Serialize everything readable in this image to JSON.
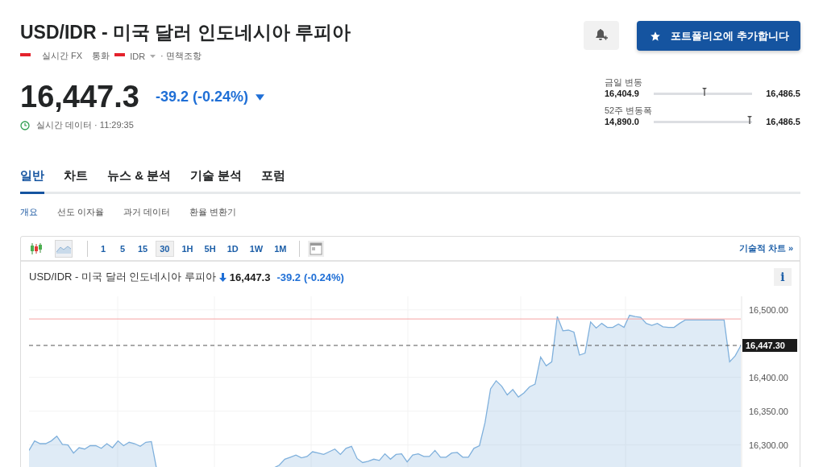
{
  "header": {
    "title": "USD/IDR - 미국 달러 인도네시아 루피아",
    "market": "실시간 FX",
    "type": "통화",
    "currency": "IDR",
    "disclaimer": "· 면책조항"
  },
  "portfolio_button": {
    "label": "포트폴리오에 추가합니다"
  },
  "quote": {
    "price": "16,447.3",
    "change": "-39.2 (-0.24%)",
    "time_label": "실시간 데이터 · 11:29:35"
  },
  "ranges": [
    {
      "label": "금일 변동",
      "low": "16,404.9",
      "high": "16,486.5",
      "level": 0.52
    },
    {
      "label": "52주 변동폭",
      "low": "14,890.0",
      "high": "16,486.5",
      "level": 0.98
    }
  ],
  "tabs": [
    {
      "label": "일반",
      "selected": true
    },
    {
      "label": "차트",
      "selected": false
    },
    {
      "label": "뉴스 & 분석",
      "selected": false
    },
    {
      "label": "기술 분석",
      "selected": false
    },
    {
      "label": "포럼",
      "selected": false
    }
  ],
  "subtabs": [
    {
      "label": "개요",
      "selected": true
    },
    {
      "label": "선도 이자율",
      "selected": false
    },
    {
      "label": "과거 데이터",
      "selected": false
    },
    {
      "label": "환율 변환기",
      "selected": false
    }
  ],
  "chart_widget": {
    "chart_types": [
      {
        "kind": "candlestick",
        "selected": false
      },
      {
        "kind": "area",
        "selected": true
      }
    ],
    "intervals": [
      {
        "label": "1",
        "selected": false
      },
      {
        "label": "5",
        "selected": false
      },
      {
        "label": "15",
        "selected": false
      },
      {
        "label": "30",
        "selected": true
      },
      {
        "label": "1H",
        "selected": false
      },
      {
        "label": "5H",
        "selected": false
      },
      {
        "label": "1D",
        "selected": false
      },
      {
        "label": "1W",
        "selected": false
      },
      {
        "label": "1M",
        "selected": false
      }
    ],
    "link": "기술적 차트 »",
    "title": "USD/IDR - 미국 달러 인도네시아 루피아",
    "price": "16,447.3",
    "change": "-39.2",
    "change_pct": "(-0.24%)",
    "info": "i",
    "chart_data": {
      "type": "area",
      "grid": true,
      "ylim": [
        16240,
        16520
      ],
      "yticks": [
        {
          "value": 16300,
          "label": "16,300.00"
        },
        {
          "value": 16350,
          "label": "16,350.00"
        },
        {
          "value": 16400,
          "label": "16,400.00"
        },
        {
          "value": 16500,
          "label": "16,500.00"
        }
      ],
      "series": [
        {
          "color": "#7fb0dc",
          "values": [
            16292,
            16306,
            16302,
            16302,
            16306,
            16313,
            16301,
            16300,
            16288,
            16296,
            16294,
            16299,
            16299,
            16295,
            16302,
            16296,
            16306,
            16299,
            16304,
            16302,
            16298,
            16304,
            16305,
            16262,
            16258,
            16255,
            16252,
            16256,
            16260,
            16257,
            16254,
            16250,
            16253,
            16258,
            16261,
            16259,
            16256,
            16252,
            16255,
            16259,
            16263,
            16260,
            16257,
            16262,
            16266,
            16270,
            16279,
            16282,
            16285,
            16281,
            16283,
            16290,
            16288,
            16286,
            16290,
            16294,
            16286,
            16295,
            16298,
            16280,
            16274,
            16276,
            16279,
            16277,
            16287,
            16279,
            16286,
            16287,
            16275,
            16285,
            16287,
            16283,
            16283,
            16292,
            16282,
            16282,
            16288,
            16289,
            16282,
            16282,
            16295,
            16299,
            16333,
            16383,
            16395,
            16387,
            16374,
            16382,
            16371,
            16377,
            16386,
            16390,
            16430,
            16417,
            16423,
            16490,
            16469,
            16470,
            16467,
            16433,
            16436,
            16482,
            16473,
            16480,
            16474,
            16474,
            16479,
            16474,
            16492,
            16490,
            16489,
            16480,
            16477,
            16480,
            16475,
            16474,
            16474,
            16480,
            16485,
            16485,
            16485,
            16485,
            16485,
            16485,
            16485,
            16485,
            16423,
            16432,
            16447
          ]
        }
      ],
      "ref_lines": [
        {
          "axis": "y",
          "value": 16486.5,
          "color": "#f5a3a3"
        },
        {
          "axis": "y",
          "value": 16447.3,
          "color": "#555555",
          "label": "16,447.30"
        }
      ]
    }
  }
}
